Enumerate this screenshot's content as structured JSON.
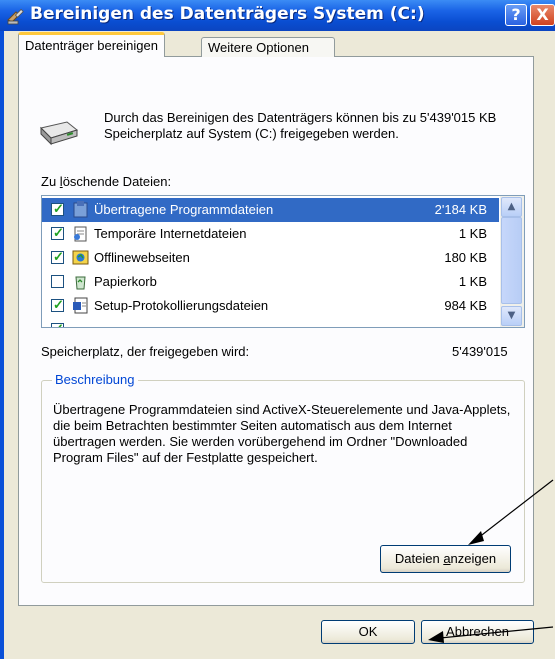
{
  "window": {
    "title": "Bereinigen des Datenträgers System (C:)",
    "help_label": "?",
    "close_label": "X"
  },
  "tabs": [
    {
      "label": "Datenträger bereinigen",
      "active": true
    },
    {
      "label": "Weitere Optionen",
      "active": false
    }
  ],
  "intro_text": "Durch das Bereinigen des Datenträgers können bis zu 5'439'015 KB Speicherplatz auf System (C:) freigegeben werden.",
  "files_label": "Zu löschende Dateien:",
  "files": [
    {
      "name": "Übertragene Programmdateien",
      "size": "2'184 KB",
      "checked": true,
      "selected": true,
      "icon": "program-files-icon"
    },
    {
      "name": "Temporäre Internetdateien",
      "size": "1 KB",
      "checked": true,
      "selected": false,
      "icon": "internet-files-icon"
    },
    {
      "name": "Offlinewebseiten",
      "size": "180 KB",
      "checked": true,
      "selected": false,
      "icon": "offline-pages-icon"
    },
    {
      "name": "Papierkorb",
      "size": "1 KB",
      "checked": false,
      "selected": false,
      "icon": "recycle-bin-icon"
    },
    {
      "name": "Setup-Protokollierungsdateien",
      "size": "984 KB",
      "checked": true,
      "selected": false,
      "icon": "log-file-icon"
    }
  ],
  "space": {
    "label": "Speicherplatz, der freigegeben wird:",
    "value": "5'439'015"
  },
  "description": {
    "title": "Beschreibung",
    "text": "Übertragene Programmdateien sind ActiveX-Steuerelemente und Java-Applets, die beim Betrachten bestimmter Seiten automatisch aus dem Internet übertragen werden. Sie werden vorübergehend im Ordner \"Downloaded Program Files\" auf der Festplatte gespeichert."
  },
  "buttons": {
    "show_files_pre": "Dateien ",
    "show_files_u": "a",
    "show_files_post": "nzeigen",
    "ok": "OK",
    "cancel": "Abbrechen"
  },
  "colors": {
    "titlebar": "#0a4ed2",
    "selection": "#316ac5",
    "tab_highlight": "#ffc83c",
    "group_title": "#0046d5"
  }
}
